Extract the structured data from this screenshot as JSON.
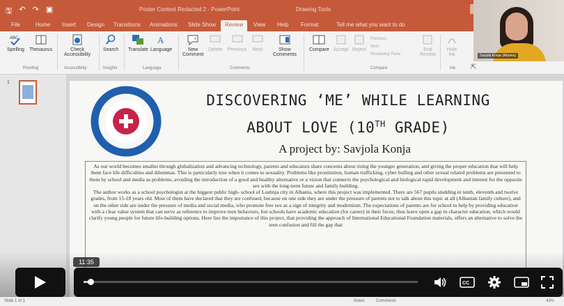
{
  "titlebar": {
    "doc_title": "Poster Contest Redacted 2 - PowerPoint",
    "contextual_label": "Drawing Tools"
  },
  "menu": {
    "tabs": [
      "File",
      "Home",
      "Insert",
      "Design",
      "Transitions",
      "Animations",
      "Slide Show",
      "Review",
      "View",
      "Help",
      "Format"
    ],
    "active_tab": "Review",
    "tell_me": "Tell me what you want to do"
  },
  "ribbon": {
    "spelling": "Spelling",
    "thesaurus": "Thesaurus",
    "check_accessibility_1": "Check",
    "check_accessibility_2": "Accessibility",
    "search": "Search",
    "translate": "Translate",
    "language": "Language",
    "new_comment_1": "New",
    "new_comment_2": "Comment",
    "delete": "Delete",
    "previous": "Previous",
    "next": "Next",
    "show_comments_1": "Show",
    "show_comments_2": "Comments",
    "compare": "Compare",
    "accept": "Accept",
    "reject": "Reject",
    "previous_change": "Previous",
    "next_change": "Next",
    "reviewing_pane": "Reviewing Pane",
    "end_review_1": "End",
    "end_review_2": "Review",
    "hide_ink_1": "Hide",
    "hide_ink_2": "Ink",
    "groups": {
      "proofing": "Proofing",
      "accessibility": "Accessibility",
      "insights": "Insights",
      "language": "Language",
      "comments": "Comments",
      "compare": "Compare",
      "ink": "Ink"
    }
  },
  "webcam": {
    "name": "Savjola Konja (Albania)"
  },
  "thumbnails": {
    "slide_number": "1"
  },
  "slide": {
    "title_line1": "DISCOVERING ‘ME’ WHILE LEARNING",
    "title_line2_pre": "ABOUT LOVE (10",
    "title_line2_sup": "TH",
    "title_line2_post": " GRADE)",
    "subtitle": "A project by: Savjola Konja",
    "paragraph1": "As our world becomes smaller through globalization and advancing technology, parents and educators share concerns about rising the younger generation, and giving the proper education that will help them face life difficulties and dilemmas. This is particularly true when it comes to sexuality. Problems like prostitution, human trafficking, cyber bulling and other sexual related problems are presented to them by school and media as problems, avoiding the introduction of a good and healthy alternative or a vision that connects the psychological and biological rapid development and interest for the opposite sex with the long-term future and family building.",
    "paragraph2": "The author works as a school psychologist at the biggest public high- school of Lushnja city in Albania, where this project was implemented. There are 567 pupils studding in tenth, eleventh and twelve grades, from 15-18 years old. Most of them have declared that they are confused, because on one side they are under the pressure of parents not to talk about this topic at all (Albanian family culture), and on the other side are under the pressure of media and social media, who promote free sex as a sign of integrity and modernism. The expectations of parents are for school to help by providing education with a clear value system that can serve as reference to improve teen behaviors, but schools have academic education (for career) in their focus, thus leave open a gap in character education, which would clarify young people for future life-building options. Here lies the importance of this project, that providing the approach of International Educational Foundation materials, offers an alternative to solve the teen confusion and fill the gap that"
  },
  "video": {
    "time": "11:35",
    "progress": 0.02
  },
  "statusbar": {
    "slide_info": "Slide 1 of 1",
    "notes": "Notes",
    "comments": "Comments",
    "zoom": "43%"
  },
  "colors": {
    "accent": "#c55a3b",
    "logo_blue": "#1f5fae",
    "logo_red": "#c8234a"
  }
}
